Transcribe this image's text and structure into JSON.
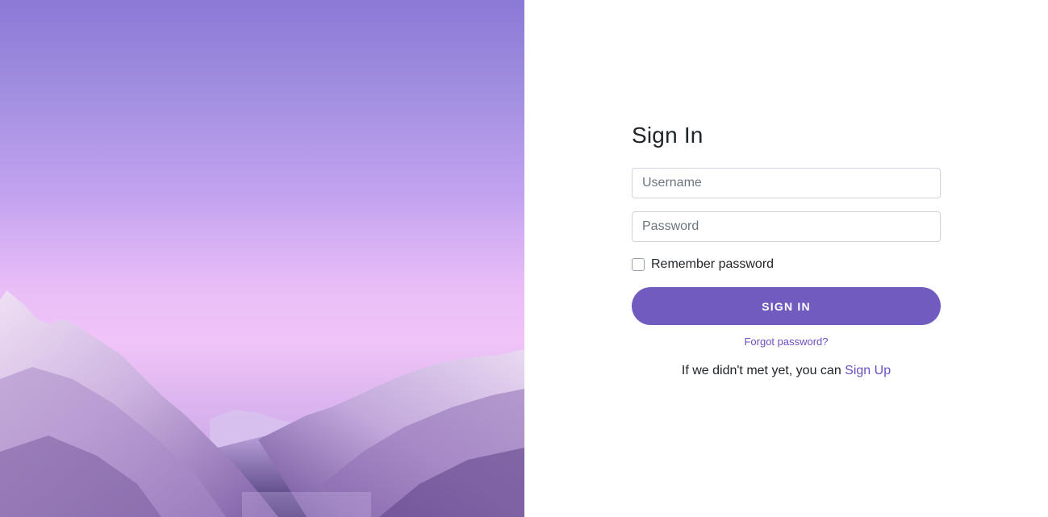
{
  "login": {
    "title": "Sign In",
    "username_placeholder": "Username",
    "password_placeholder": "Password",
    "remember_label": "Remember password",
    "remember_checked": false,
    "signin_label": "SIGN IN",
    "forgot_label": "Forgot password?",
    "signup_prompt": "If we didn't met yet, you can",
    "signup_link_label": "Sign Up"
  },
  "colors": {
    "accent": "#715bbf",
    "link": "#6b4fc0",
    "sky_top": "#8b79d6",
    "sky_bottom": "#f0c4f8"
  }
}
